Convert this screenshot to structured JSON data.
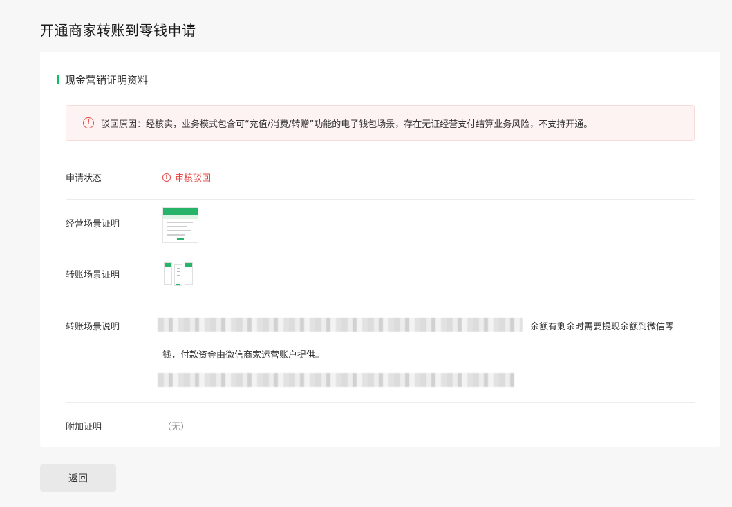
{
  "page_title": "开通商家转账到零钱申请",
  "section_title": "现金营销证明资料",
  "alert": {
    "icon": "warning-circle-icon",
    "text": "驳回原因：经核实，业务模式包含可“充值/消费/转赠”功能的电子钱包场景，存在无证经营支付结算业务风险，不支持开通。"
  },
  "fields": {
    "status_label": "申请状态",
    "status_value": "审核驳回",
    "business_scene_label": "经营场景证明",
    "transfer_scene_label": "转账场景证明",
    "transfer_desc_label": "转账场景说明",
    "transfer_desc_visible_1": "余额有剩余时需要提现余额到微信零",
    "transfer_desc_visible_2": "钱，付款资金由微信商家运营账户提供。",
    "extra_proof_label": "附加证明",
    "extra_proof_value": "（无）"
  },
  "colors": {
    "accent": "#07c160",
    "error": "#e64340",
    "alert_bg": "#fdf3f2"
  },
  "back_button": "返回"
}
